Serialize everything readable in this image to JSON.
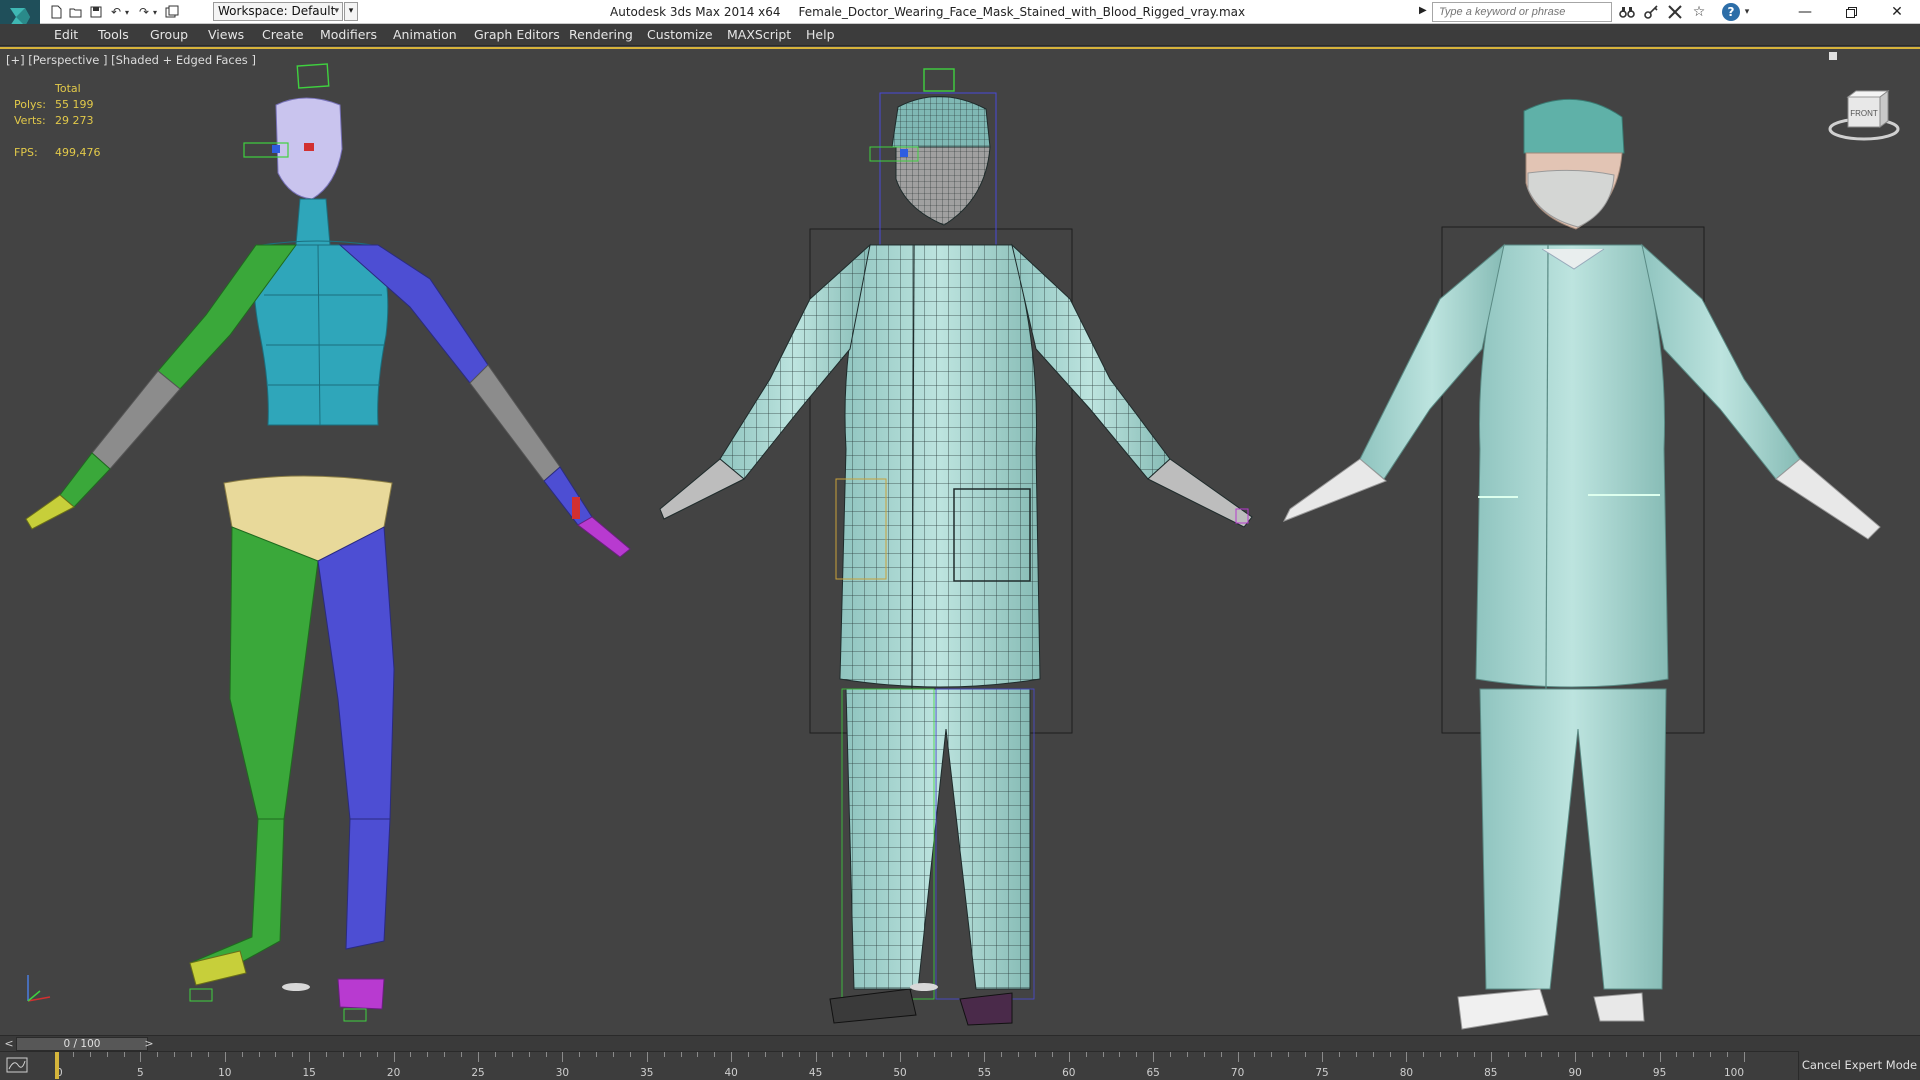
{
  "title_bar": {
    "workspace_label": "Workspace: Default",
    "app_name": "Autodesk 3ds Max  2014 x64",
    "file_name": "Female_Doctor_Wearing_Face_Mask_Stained_with_Blood_Rigged_vray.max",
    "search_placeholder": "Type a keyword or phrase",
    "icons": [
      "new-file-icon",
      "open-folder-icon",
      "save-icon",
      "undo-icon",
      "redo-icon",
      "project-folder-icon",
      "binoculars-icon",
      "key-icon",
      "autodesk-exchange-icon",
      "star-icon",
      "help-icon",
      "minimize-icon",
      "restore-icon",
      "close-icon"
    ]
  },
  "menu": {
    "items": [
      "Edit",
      "Tools",
      "Group",
      "Views",
      "Create",
      "Modifiers",
      "Animation",
      "Graph Editors",
      "Rendering",
      "Customize",
      "MAXScript",
      "Help"
    ]
  },
  "viewport": {
    "label": "[+] [Perspective ] [Shaded + Edged Faces ]",
    "stats": {
      "header": "Total",
      "polys_label": "Polys:",
      "polys_value": "55 199",
      "verts_label": "Verts:",
      "verts_value": "29 273",
      "fps_label": "FPS:",
      "fps_value": "499,476"
    },
    "viewcube_label": "FRONT",
    "colors": {
      "background": "#434343",
      "active_border": "#d7b33b",
      "stats_text": "#e2c94a",
      "left_arm_green": "#3aa83a",
      "right_arm_blue": "#4d4ed3",
      "torso_cyan": "#2fa6ba",
      "pelvis_yellow": "#e8d99a",
      "gown_teal": "#a8d8d2"
    }
  },
  "timeline": {
    "slider_value": "0 / 100",
    "current_frame": 0,
    "total_frames": 100,
    "tick_labels": [
      "0",
      "5",
      "10",
      "15",
      "20",
      "25",
      "30",
      "35",
      "40",
      "45",
      "50",
      "55",
      "60",
      "65",
      "70",
      "75",
      "80",
      "85",
      "90",
      "95",
      "100"
    ]
  },
  "status": {
    "cancel_expert_mode": "Cancel Expert Mode"
  }
}
